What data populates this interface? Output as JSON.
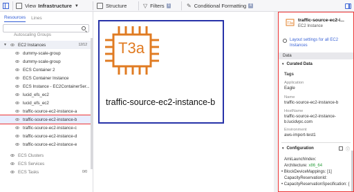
{
  "toolbar": {
    "view_label": "View",
    "view_value": "Infrastructure",
    "structure_label": "Structure",
    "filters_label": "Filters",
    "filters_count": "1",
    "conditional_label": "Conditional Formatting",
    "conditional_count": "4"
  },
  "sidebar": {
    "tabs": [
      "Resources",
      "Lines"
    ],
    "search_placeholder": "",
    "partial_top": "Autoscaling Groups",
    "group": {
      "label": "EC2 Instances",
      "count": "12/12"
    },
    "items": [
      "dummy-scale-group",
      "dummy-scale-group",
      "ECS Container 2",
      "ECS Container Instance",
      "ECS Instance - EC2ContainerSer...",
      "lucid_efs_ec2",
      "lucid_efs_ec2",
      "traffic-source-ec2-instance-a",
      "traffic-source-ec2-instance-b",
      "traffic-source-ec2-instance-c",
      "traffic-source-ec2-instance-d",
      "traffic-source-ec2-instance-e"
    ],
    "collapsed_groups": [
      "ECS Clusters",
      "ECS Services",
      "ECS Tasks"
    ],
    "collapsed_counts": [
      "",
      "",
      "0/0"
    ]
  },
  "canvas": {
    "chip_text": "T3a",
    "instance_label": "traffic-source-ec2-instance-b"
  },
  "panel": {
    "title": "traffic-source-ec2-i...",
    "subtitle": "EC2 Instance",
    "layout_link": "Layout settings for all EC2 Instances",
    "data_header": "Data",
    "curated_header": "Curated Data",
    "tags_label": "Tags",
    "fields": [
      {
        "key": "Application",
        "value": "Eagle"
      },
      {
        "key": "Name",
        "value": "traffic-source-ec2-instance-b"
      },
      {
        "key": "HostName",
        "value": "traffic-source-ec2-instance-b.lucidvpc.com"
      },
      {
        "key": "Environment",
        "value": "aws-import-test1"
      }
    ],
    "config_header": "Configuration",
    "config_rows": [
      {
        "key": "AmiLaunchIndex:",
        "value": ""
      },
      {
        "key": "Architecture:",
        "value": "x86_64"
      },
      {
        "key": "BlockDeviceMappings:",
        "value": "[1]"
      },
      {
        "key": "CapacityReservationId:",
        "value": ""
      },
      {
        "key": "CapacityReservationSpecification:",
        "value": "{"
      }
    ]
  },
  "colors": {
    "accent": "#2f5cd6",
    "ec2_orange": "#e07b22",
    "box_border": "#2631a8",
    "selection": "#ee3333"
  }
}
